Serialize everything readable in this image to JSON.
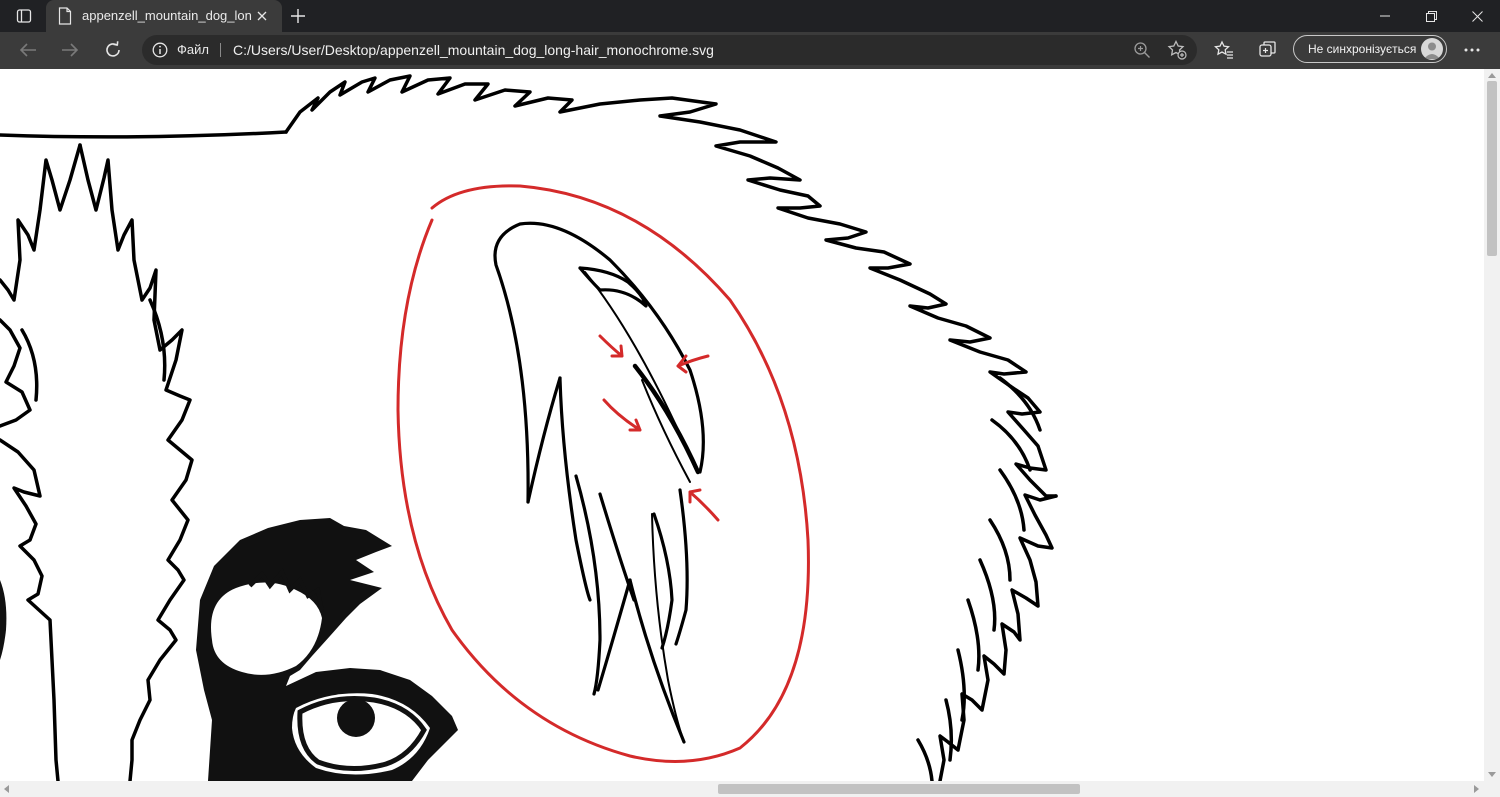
{
  "tab": {
    "title": "appenzell_mountain_dog_long-h"
  },
  "address_bar": {
    "site_info_label": "Файл",
    "url": "C:/Users/User/Desktop/appenzell_mountain_dog_long-hair_monochrome.svg"
  },
  "profile": {
    "label": "Не синхронізується"
  },
  "icons": [
    "tab-actions-icon",
    "file-icon",
    "close-icon",
    "plus-icon",
    "minimize-icon",
    "restore-icon",
    "window-close-icon",
    "back-arrow-icon",
    "forward-arrow-icon",
    "refresh-icon",
    "info-icon",
    "zoom-icon",
    "add-favorite-icon",
    "favorites-icon",
    "collections-icon",
    "avatar-icon",
    "more-icon"
  ],
  "colors": {
    "tab_strip": "#202124",
    "toolbar": "#3b3b3b",
    "annotation_red": "#d42a2a",
    "drawing_stroke": "#000000"
  },
  "viewer": {
    "content": "monochrome line-art SVG of a dog's head with red hand-drawn annotation circle and arrows",
    "scroll": {
      "vertical_position": 0.0,
      "horizontal_position": 0.5
    }
  }
}
